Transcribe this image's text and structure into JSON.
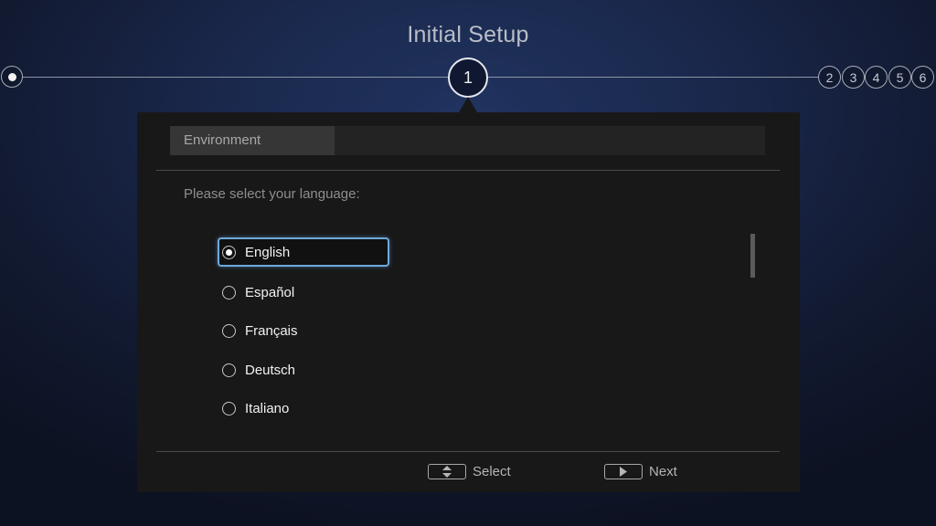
{
  "header": {
    "title": "Initial Setup"
  },
  "steps": {
    "current": "1",
    "upcoming": [
      "2",
      "3",
      "4",
      "5",
      "6"
    ]
  },
  "panel": {
    "tab_label": "Environment",
    "prompt": "Please select your language:",
    "languages": [
      {
        "label": "English",
        "selected": true
      },
      {
        "label": "Español",
        "selected": false
      },
      {
        "label": "Français",
        "selected": false
      },
      {
        "label": "Deutsch",
        "selected": false
      },
      {
        "label": "Italiano",
        "selected": false
      }
    ]
  },
  "footer": {
    "select_label": "Select",
    "next_label": "Next"
  },
  "colors": {
    "focus_outline": "#6ea8d8",
    "background": "#1a284c",
    "panel": "#181818"
  }
}
